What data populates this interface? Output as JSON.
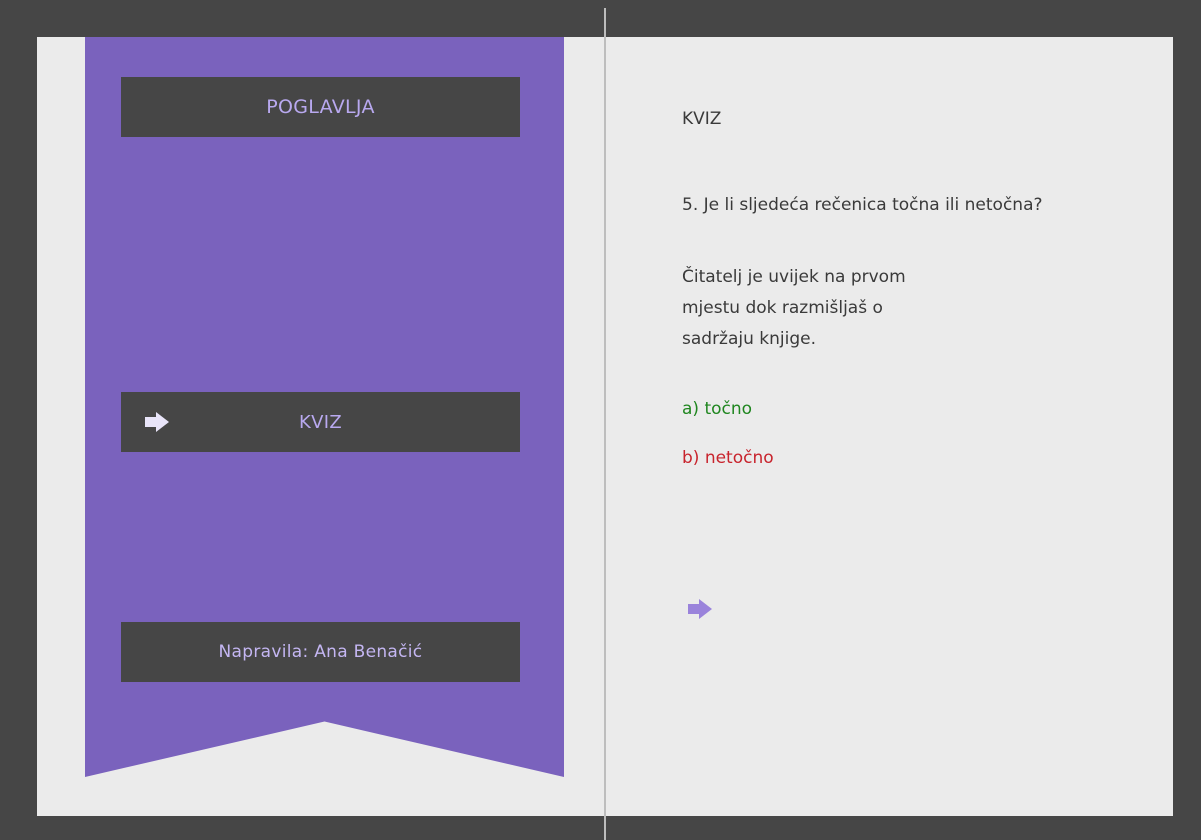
{
  "sidebar": {
    "title": "POGLAVLJA",
    "items": [
      {
        "label": "KVIZ",
        "icon": "arrow-right-icon"
      }
    ],
    "credit": "Napravila: Ana Benačić"
  },
  "quiz": {
    "title": "KVIZ",
    "question": "5. Je li sljedeća rečenica točna ili netočna?",
    "statement": "Čitatelj je uvijek na prvom mjestu dok razmišljaš o sadržaju knjige.",
    "answers": [
      {
        "label": "a) točno",
        "color": "#1f861f"
      },
      {
        "label": "b) netočno",
        "color": "#c8242d"
      }
    ],
    "next_icon": "arrow-right-icon"
  },
  "colors": {
    "ribbon": "#7a62bd",
    "accent_text": "#b9a9f0",
    "background": "#464646",
    "page": "#ebebeb"
  }
}
